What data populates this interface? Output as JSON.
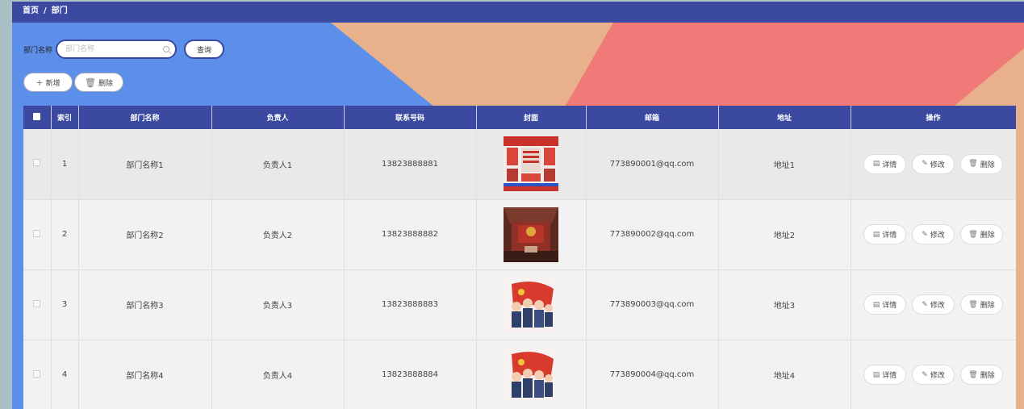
{
  "breadcrumb": {
    "home": "首页",
    "separator": "/",
    "current": "部门"
  },
  "search": {
    "label": "部门名称",
    "placeholder": "部门名称",
    "button": "查询"
  },
  "actions": {
    "add": "新增",
    "delete": "删除"
  },
  "table": {
    "headers": [
      "索引",
      "部门名称",
      "负责人",
      "联系号码",
      "封面",
      "邮箱",
      "地址",
      "操作"
    ],
    "ops": {
      "detail": "详情",
      "edit": "修改",
      "delete": "删除"
    },
    "rows": [
      {
        "index": "1",
        "name": "部门名称1",
        "leader": "负责人1",
        "phone": "13823888881",
        "email": "773890001@qq.com",
        "address": "地址1"
      },
      {
        "index": "2",
        "name": "部门名称2",
        "leader": "负责人2",
        "phone": "13823888882",
        "email": "773890002@qq.com",
        "address": "地址2"
      },
      {
        "index": "3",
        "name": "部门名称3",
        "leader": "负责人3",
        "phone": "13823888883",
        "email": "773890003@qq.com",
        "address": "地址3"
      },
      {
        "index": "4",
        "name": "部门名称4",
        "leader": "负责人4",
        "phone": "13823888884",
        "email": "773890004@qq.com",
        "address": "地址4"
      }
    ]
  },
  "colors": {
    "primary": "#3b4aa0",
    "bg_blue": "#5b8fea",
    "bg_peach": "#e8b08b",
    "bg_coral": "#f07a78"
  }
}
